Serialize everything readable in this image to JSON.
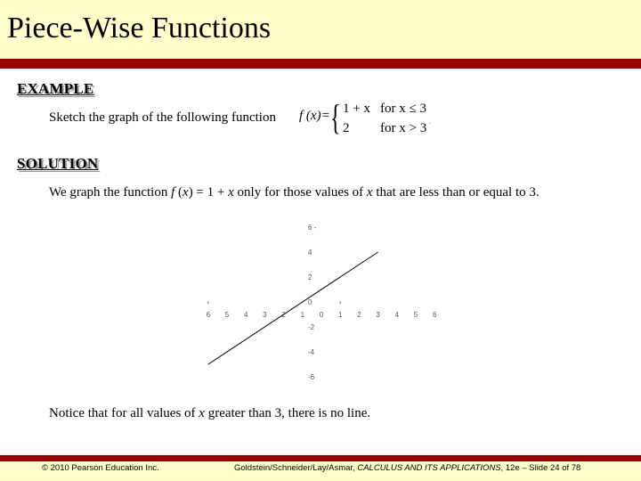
{
  "slide": {
    "title": "Piece-Wise Functions",
    "example_heading": "EXAMPLE",
    "example_prompt": "Sketch the graph of the following function",
    "formula": {
      "lhs": "f (x)=",
      "case1_expr": "1 + x",
      "case1_cond": "for x ≤ 3",
      "case2_expr": "2",
      "case2_cond": "for x > 3",
      "trailing": "."
    },
    "solution_heading": "SOLUTION",
    "solution_parts": {
      "p1": "We graph the function ",
      "f": "f",
      "p2": " (",
      "x1": "x",
      "p3": ") = 1 + ",
      "x2": "x",
      "p4": " only for those values of ",
      "x3": "x",
      "p5": " that are less than or equal to 3."
    },
    "notice_parts": {
      "p1": "Notice that for all values of ",
      "x": "x",
      "p2": " greater than 3, there is no line."
    },
    "footer": {
      "copyright": "© 2010 Pearson Education Inc.",
      "citation_authors": "Goldstein/Schneider/Lay/Asmar, ",
      "citation_book": "CALCULUS AND ITS APPLICATIONS",
      "citation_rest": ", 12e – Slide 24 of 78"
    }
  },
  "colors": {
    "header_background": "#ffffcc",
    "accent_bar": "#990000",
    "body_background": "#ffffff"
  },
  "chart_data": {
    "type": "line",
    "title": "",
    "xlabel": "",
    "ylabel": "",
    "xlim": [
      -6,
      6
    ],
    "ylim": [
      -6,
      6
    ],
    "grid": false,
    "x_tick_labels": [
      "6",
      "5",
      "4",
      "3",
      "2",
      "1",
      "0",
      "1",
      "2",
      "3",
      "4",
      "5",
      "6"
    ],
    "x_tick_values": [
      -6,
      -5,
      -4,
      -3,
      -2,
      -1,
      0,
      1,
      2,
      3,
      4,
      5,
      6
    ],
    "y_tick_labels": [
      "6 -",
      "4",
      "2",
      "0",
      "-2",
      "-4",
      "-6"
    ],
    "y_tick_values": [
      6,
      4,
      2,
      0,
      -2,
      -4,
      -6
    ],
    "series": [
      {
        "name": "f(x) = 1 + x, x ≤ 3",
        "x": [
          -6,
          3
        ],
        "y": [
          -5,
          4
        ]
      }
    ]
  }
}
